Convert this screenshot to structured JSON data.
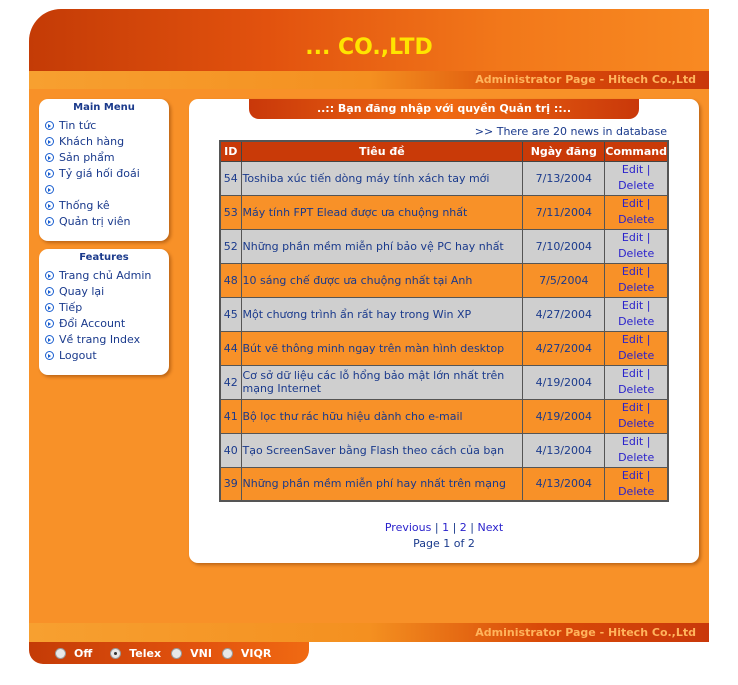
{
  "header": {
    "title": "... CO.,LTD",
    "admin_bar": "Administrator Page - Hitech Co.,Ltd"
  },
  "footer": {
    "admin_bar": "Administrator Page - Hitech Co.,Ltd"
  },
  "main_menu": {
    "title": "Main Menu",
    "items": [
      "Tin tức",
      "Khách hàng",
      "Sản phẩm",
      "Tỷ giá hối đoái",
      "",
      "Thống kê",
      "Quản trị viên"
    ]
  },
  "features": {
    "title": "Features",
    "items": [
      "Trang chủ Admin",
      "Quay lại",
      "Tiếp",
      "Đổi Account",
      "Về trang Index",
      "Logout"
    ]
  },
  "content": {
    "tab_title": "..:: Bạn đăng nhập với quyền Quản trị ::..",
    "news_count": ">> There are 20 news in database",
    "columns": [
      "ID",
      "Tiêu đề",
      "Ngày đăng",
      "Command"
    ],
    "edit_label": "Edit |",
    "delete_label": "Delete",
    "rows": [
      {
        "id": "54",
        "title": "Toshiba xúc tiến dòng máy tính xách tay mới",
        "date": "7/13/2004"
      },
      {
        "id": "53",
        "title": "Máy tính FPT Elead được ưa chuộng nhất",
        "date": "7/11/2004"
      },
      {
        "id": "52",
        "title": "Những phần mềm miễn phí bảo vệ PC hay nhất",
        "date": "7/10/2004"
      },
      {
        "id": "48",
        "title": "10 sáng chế được ưa chuộng nhất tại Anh",
        "date": "7/5/2004"
      },
      {
        "id": "45",
        "title": "Một chương trình ẩn rất hay trong Win XP",
        "date": "4/27/2004"
      },
      {
        "id": "44",
        "title": "Bút vẽ thông minh ngay trên màn hình desktop",
        "date": "4/27/2004"
      },
      {
        "id": "42",
        "title": "Cơ sở dữ liệu các lỗ hổng bảo mật lớn nhất trên mạng Internet",
        "date": "4/19/2004"
      },
      {
        "id": "41",
        "title": "Bộ lọc thư rác hữu hiệu dành cho e-mail",
        "date": "4/19/2004"
      },
      {
        "id": "40",
        "title": "Tạo ScreenSaver bằng Flash theo cách của bạn",
        "date": "4/13/2004"
      },
      {
        "id": "39",
        "title": "Những phần mềm miễn phí hay nhất trên mạng",
        "date": "4/13/2004"
      }
    ],
    "pager": {
      "previous": "Previous",
      "sep": "|",
      "page1": "1",
      "page2": "2",
      "next": "Next",
      "info": "Page 1 of 2"
    }
  },
  "ime": {
    "options": [
      "Off",
      "Telex",
      "VNI",
      "VIQR"
    ],
    "selected": "Telex"
  },
  "colors": {
    "accent": "#f89128",
    "dark_orange": "#c93a08",
    "title_yellow": "#ffe400",
    "link": "#2a22cc"
  }
}
